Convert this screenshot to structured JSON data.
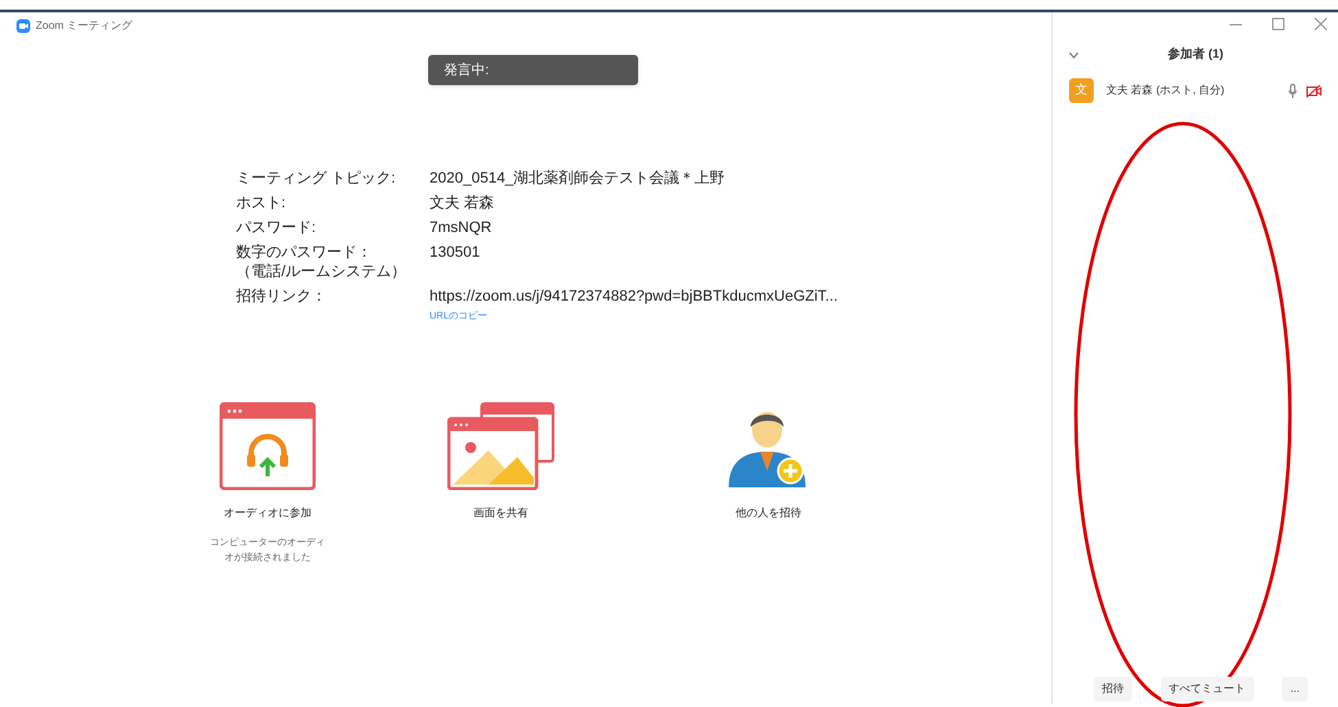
{
  "window": {
    "title": "Zoom ミーティング"
  },
  "tooltip": {
    "text": "発言中:"
  },
  "meeting_info": [
    {
      "label": "ミーティング トピック:",
      "value": "2020_0514_湖北薬剤師会テスト会議＊上野"
    },
    {
      "label": "ホスト:",
      "value": "文夫 若森"
    },
    {
      "label": "パスワード:",
      "value": "7msNQR"
    },
    {
      "label": "数字のパスワード：",
      "sublabel": "（電話/ルームシステム）",
      "value": "130501"
    },
    {
      "label": "招待リンク：",
      "value": "https://zoom.us/j/94172374882?pwd=bjBBTkducmxUeGZiT...",
      "link": "URLのコピー"
    }
  ],
  "actions": [
    {
      "kind": "audio",
      "label": "オーディオに参加",
      "note": "コンピューターのオーディオが接続されました"
    },
    {
      "kind": "share",
      "label": "画面を共有"
    },
    {
      "kind": "invite",
      "label": "他の人を招待"
    }
  ],
  "participants_panel": {
    "title": "参加者 (1)",
    "participants": [
      {
        "avatar": "文",
        "name": "文夫 若森 (ホスト, 自分)",
        "muted": false,
        "video_off": true
      }
    ],
    "buttons": [
      "招待",
      "すべてミュート",
      "..."
    ]
  },
  "annotations": [
    {
      "kind": "ellipse"
    }
  ]
}
